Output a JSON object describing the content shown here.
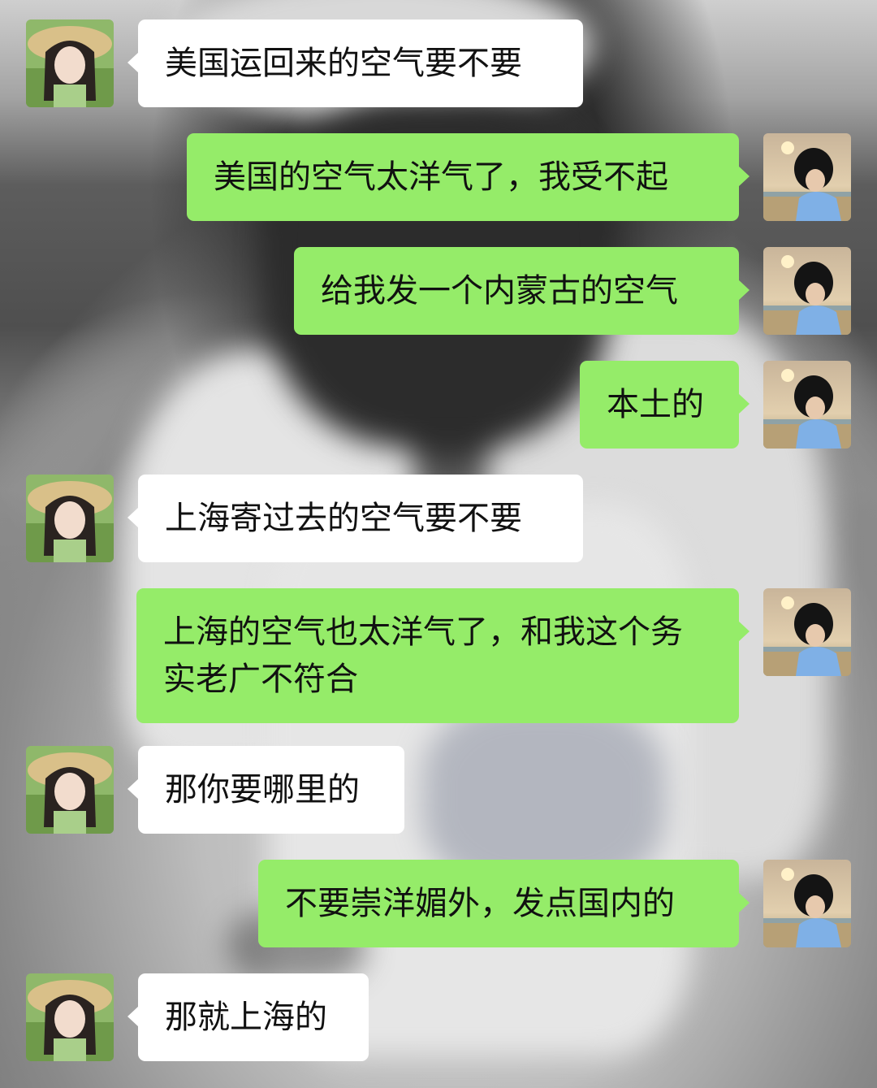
{
  "colors": {
    "incoming_bubble": "#ffffff",
    "outgoing_bubble": "#95ec69",
    "text": "#111111"
  },
  "avatars": {
    "contact": "avatar-girl-straw-hat",
    "self": "avatar-boy-sunset-beach"
  },
  "messages": [
    {
      "sender": "contact",
      "text": "美国运回来的空气要不要"
    },
    {
      "sender": "self",
      "text": "美国的空气太洋气了，我受不起"
    },
    {
      "sender": "self",
      "text": "给我发一个内蒙古的空气"
    },
    {
      "sender": "self",
      "text": "本土的"
    },
    {
      "sender": "contact",
      "text": "上海寄过去的空气要不要"
    },
    {
      "sender": "self",
      "text": "上海的空气也太洋气了，和我这个务实老广不符合"
    },
    {
      "sender": "contact",
      "text": "那你要哪里的"
    },
    {
      "sender": "self",
      "text": "不要崇洋媚外，发点国内的"
    },
    {
      "sender": "contact",
      "text": "那就上海的"
    }
  ]
}
